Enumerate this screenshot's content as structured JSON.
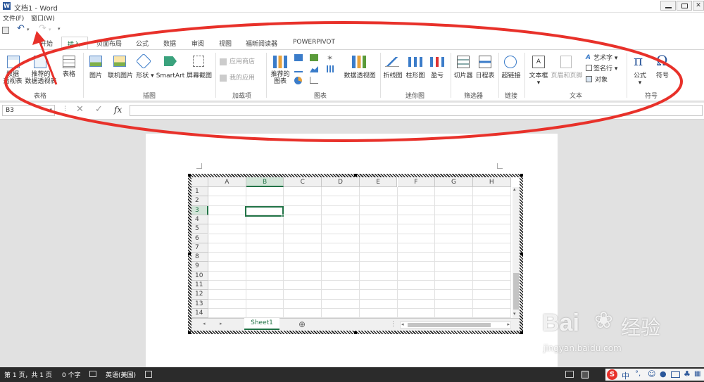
{
  "window": {
    "title": "文档1 - Word",
    "app_icon": "word-icon"
  },
  "menubar": {
    "items": [
      "文件(F)",
      "窗口(W)"
    ]
  },
  "tabs": [
    "开始",
    "插入",
    "页面布局",
    "公式",
    "数据",
    "审阅",
    "视图",
    "福昕阅读器",
    "POWERPIVOT"
  ],
  "active_tab": "插入",
  "ribbon": {
    "table_group": {
      "label": "表格",
      "btn_pivot": "数据\n透视表",
      "btn_recommended": "推荐的\n数据透视表",
      "btn_table": "表格"
    },
    "illus_group": {
      "label": "插图",
      "btn_picture": "图片",
      "btn_online": "联机图片",
      "btn_shape": "形状",
      "btn_smartart": "SmartArt",
      "btn_screenshot": "屏幕截图"
    },
    "addin_group": {
      "label": "加载项",
      "btn_store": "应用商店",
      "btn_myapps": "我的应用"
    },
    "chart_group": {
      "label": "图表",
      "btn_recommended_chart": "推荐的\n图表",
      "btn_pivotchart": "数据透视图"
    },
    "spark_group": {
      "label": "迷你图",
      "btn_line": "折线图",
      "btn_column": "柱形图",
      "btn_winloss": "盈亏"
    },
    "filter_group": {
      "label": "筛选器",
      "btn_slicer": "切片器",
      "btn_timeline": "日程表"
    },
    "link_group": {
      "label": "链接",
      "btn_link": "超链接"
    },
    "text_group": {
      "label": "文本",
      "btn_textbox": "文本框",
      "btn_header": "页眉和页脚",
      "btn_wordart": "艺术字",
      "btn_sign": "签名行",
      "btn_object": "对象"
    },
    "symbol_group": {
      "label": "符号",
      "btn_equation": "公式",
      "btn_symbol": "符号"
    }
  },
  "formula_bar": {
    "name_box": "B3",
    "fx": "fx",
    "cancel": "✕",
    "enter": "✓"
  },
  "sheet": {
    "columns": [
      "A",
      "B",
      "C",
      "D",
      "E",
      "F",
      "G",
      "H"
    ],
    "rows": [
      "1",
      "2",
      "3",
      "4",
      "5",
      "6",
      "7",
      "8",
      "9",
      "10",
      "11",
      "12",
      "13",
      "14"
    ],
    "active_col": "B",
    "active_row": "3",
    "tab_name": "Sheet1",
    "add_sheet": "⊕"
  },
  "statusbar": {
    "page": "第 1 页，共 1 页",
    "words": "0 个字",
    "lang": "英语(美国)"
  },
  "ime": {
    "text": "中"
  },
  "watermark": {
    "brand": "Bai",
    "brand2": "经验",
    "url": "jingyan.baidu.com"
  },
  "colors": {
    "accent_word": "#2b579a",
    "excel_green": "#217346",
    "annotation_red": "#e8312a"
  }
}
